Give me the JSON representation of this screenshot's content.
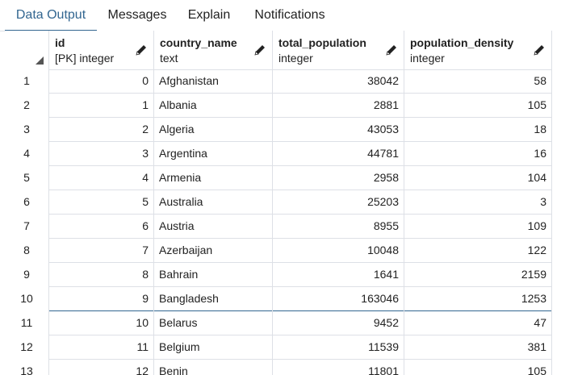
{
  "tabs": [
    {
      "label": "Data Output",
      "active": true
    },
    {
      "label": "Messages",
      "active": false
    },
    {
      "label": "Explain",
      "active": false
    },
    {
      "label": "Notifications",
      "active": false
    }
  ],
  "columns": [
    {
      "name": "id",
      "type": "[PK] integer"
    },
    {
      "name": "country_name",
      "type": "text"
    },
    {
      "name": "total_population",
      "type": "integer"
    },
    {
      "name": "population_density",
      "type": "integer"
    }
  ],
  "rows": [
    {
      "n": "1",
      "id": "0",
      "country": "Afghanistan",
      "pop": "38042",
      "density": "58"
    },
    {
      "n": "2",
      "id": "1",
      "country": "Albania",
      "pop": "2881",
      "density": "105"
    },
    {
      "n": "3",
      "id": "2",
      "country": "Algeria",
      "pop": "43053",
      "density": "18"
    },
    {
      "n": "4",
      "id": "3",
      "country": "Argentina",
      "pop": "44781",
      "density": "16"
    },
    {
      "n": "5",
      "id": "4",
      "country": "Armenia",
      "pop": "2958",
      "density": "104"
    },
    {
      "n": "6",
      "id": "5",
      "country": "Australia",
      "pop": "25203",
      "density": "3"
    },
    {
      "n": "7",
      "id": "6",
      "country": "Austria",
      "pop": "8955",
      "density": "109"
    },
    {
      "n": "8",
      "id": "7",
      "country": "Azerbaijan",
      "pop": "10048",
      "density": "122"
    },
    {
      "n": "9",
      "id": "8",
      "country": "Bahrain",
      "pop": "1641",
      "density": "2159"
    },
    {
      "n": "10",
      "id": "9",
      "country": "Bangladesh",
      "pop": "163046",
      "density": "1253"
    },
    {
      "n": "11",
      "id": "10",
      "country": "Belarus",
      "pop": "9452",
      "density": "47"
    },
    {
      "n": "12",
      "id": "11",
      "country": "Belgium",
      "pop": "11539",
      "density": "381"
    },
    {
      "n": "13",
      "id": "12",
      "country": "Benin",
      "pop": "11801",
      "density": "105"
    }
  ],
  "icons": {
    "edit": "pencil-icon",
    "select_all": "select-all-triangle-icon"
  },
  "colors": {
    "accent": "#326690",
    "border": "#dde0e6",
    "text": "#222222"
  }
}
